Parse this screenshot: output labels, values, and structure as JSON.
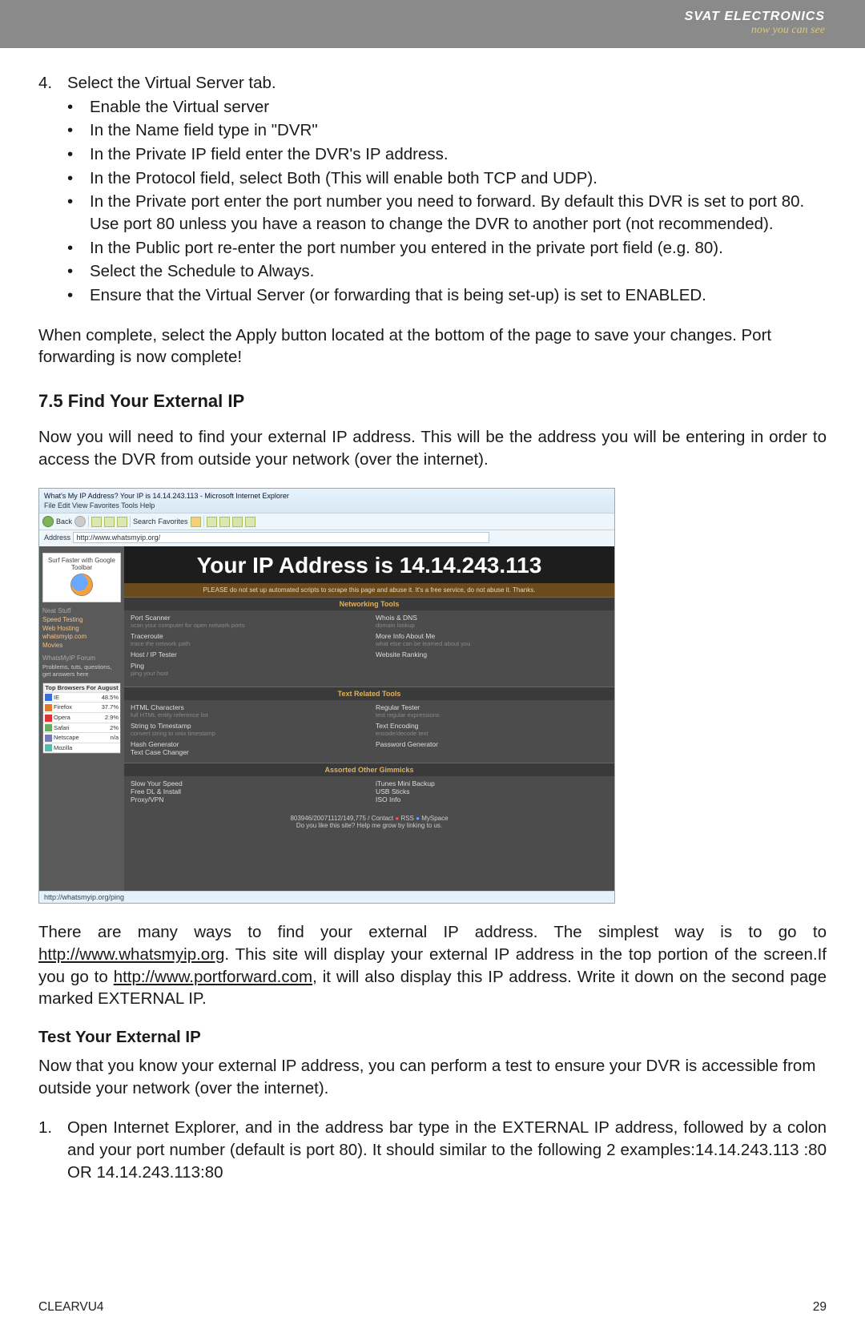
{
  "header": {
    "brand": "SVAT ELECTRONICS",
    "tagline": "now you can see"
  },
  "step4": {
    "num": "4.",
    "text": "Select the Virtual Server tab.",
    "bullets": [
      "Enable the Virtual server",
      "In the Name field type in \"DVR\"",
      "In the Private IP field enter the DVR's IP address.",
      "In the Protocol field, select Both (This will enable both TCP and UDP).",
      "In the Private port enter the port number you need to forward. By default this DVR is set to port 80. Use port 80 unless you have a reason to change the DVR to another port (not recommended).",
      "In the Public port re-enter the port number you entered in the private port field (e.g. 80).",
      "Select the Schedule to Always.",
      "Ensure that the Virtual Server (or forwarding that is being set-up) is set to ENABLED."
    ]
  },
  "para_complete": "When complete, select the Apply button located at the bottom of the page to save your changes. Port forwarding is now complete!",
  "section": {
    "heading": "7.5 Find Your External IP",
    "intro": "Now you will need to find your external IP address. This will be the address you will be entering in order to access the DVR from outside your network (over the internet)."
  },
  "screenshot": {
    "title": "What's My IP Address? Your IP is 14.14.243.113 - Microsoft Internet Explorer",
    "menu": "File   Edit   View   Favorites   Tools   Help",
    "toolbar": {
      "back": "Back",
      "search": "Search",
      "favs": "Favorites"
    },
    "address_label": "Address",
    "address_url": "http://www.whatsmyip.org/",
    "banner": "Your IP Address is 14.14.243.113",
    "sub": "PLEASE do not set up automated scripts to scrape this page and abuse it. It's a free service, do not abuse it. Thanks.",
    "sect1": "Networking Tools",
    "s1l": [
      {
        "t": "Port Scanner",
        "d": "scan your computer for open network ports"
      },
      {
        "t": "Traceroute",
        "d": "trace the network path"
      },
      {
        "t": "Host / IP Tester",
        "d": ""
      },
      {
        "t": "Ping",
        "d": "ping your host"
      }
    ],
    "s1r": [
      {
        "t": "Whois & DNS",
        "d": "domain lookup"
      },
      {
        "t": "More Info About Me",
        "d": "what else can be learned about you"
      },
      {
        "t": "Website Ranking",
        "d": ""
      }
    ],
    "sect2": "Text Related Tools",
    "s2l": [
      {
        "t": "HTML Characters",
        "d": "full HTML entity reference list"
      },
      {
        "t": "String to Timestamp",
        "d": "convert string to unix timestamp"
      },
      {
        "t": "Hash Generator",
        "d": ""
      },
      {
        "t": "Text Case Changer",
        "d": ""
      }
    ],
    "s2r": [
      {
        "t": "Regular Tester",
        "d": "test regular expressions"
      },
      {
        "t": "Text Encoding",
        "d": "encode/decode text"
      },
      {
        "t": "Password Generator",
        "d": ""
      }
    ],
    "sect3": "Assorted Other Gimmicks",
    "s3l": [
      {
        "t": "Slow Your Speed",
        "d": ""
      },
      {
        "t": "Free DL & Install",
        "d": ""
      },
      {
        "t": "Proxy/VPN",
        "d": ""
      }
    ],
    "s3r": [
      {
        "t": "iTunes Mini Backup",
        "d": ""
      },
      {
        "t": "USB Sticks",
        "d": ""
      },
      {
        "t": "ISO Info",
        "d": ""
      }
    ],
    "foot1": "803946/20071112/149,775 / Contact ",
    "foot_rss": " RSS ",
    "foot2": " MySpace ",
    "foot3": "Do you like this site? Help me grow by linking to us.",
    "status": "http://whatsmyip.org/ping",
    "sidebar": {
      "ad": "Surf Faster with Google Toolbar",
      "h1": "Neat Stuff",
      "links1": [
        "Speed Testing",
        "Web Hosting",
        "whatsmyip.com",
        "Movies"
      ],
      "h2": "WhatsMyIP Forum",
      "links2": [
        "Problems, tuts, questions, get answers here"
      ],
      "tbl_head": "Top Browsers For August",
      "rows": [
        {
          "c": "#3a6ed8",
          "n": "IE",
          "v": "48.5%"
        },
        {
          "c": "#e07a2a",
          "n": "Firefox",
          "v": "37.7%"
        },
        {
          "c": "#d33",
          "n": "Opera",
          "v": "2.9%"
        },
        {
          "c": "#6a6",
          "n": "Safari",
          "v": "2%"
        },
        {
          "c": "#77b",
          "n": "Netscape",
          "v": "n/a"
        },
        {
          "c": "#5ba",
          "n": "Mozilla",
          "v": ""
        }
      ]
    }
  },
  "after_ss": {
    "pre": "There are many ways to find your external IP address. The simplest way is to go to ",
    "link1": "http://www.whatsmyip.org",
    "mid": ". This site will display your external IP address in the top portion of the screen.If you go to ",
    "link2": "http://www.portforward.com",
    "post": ", it will also display this IP address. Write it down on the second page marked EXTERNAL IP."
  },
  "test": {
    "heading": "Test Your External IP",
    "intro": "Now that you know your external IP address, you can perform a test to ensure your DVR is accessible from outside your network (over the internet).",
    "step1_num": "1.",
    "step1": "Open Internet Explorer, and in the address bar type in the EXTERNAL IP address, followed by a colon and your port number (default is port 80). It should similar to the following 2 examples:14.14.243.113 :80 OR 14.14.243.113:80"
  },
  "footer": {
    "model": "CLEARVU4",
    "page": "29"
  }
}
